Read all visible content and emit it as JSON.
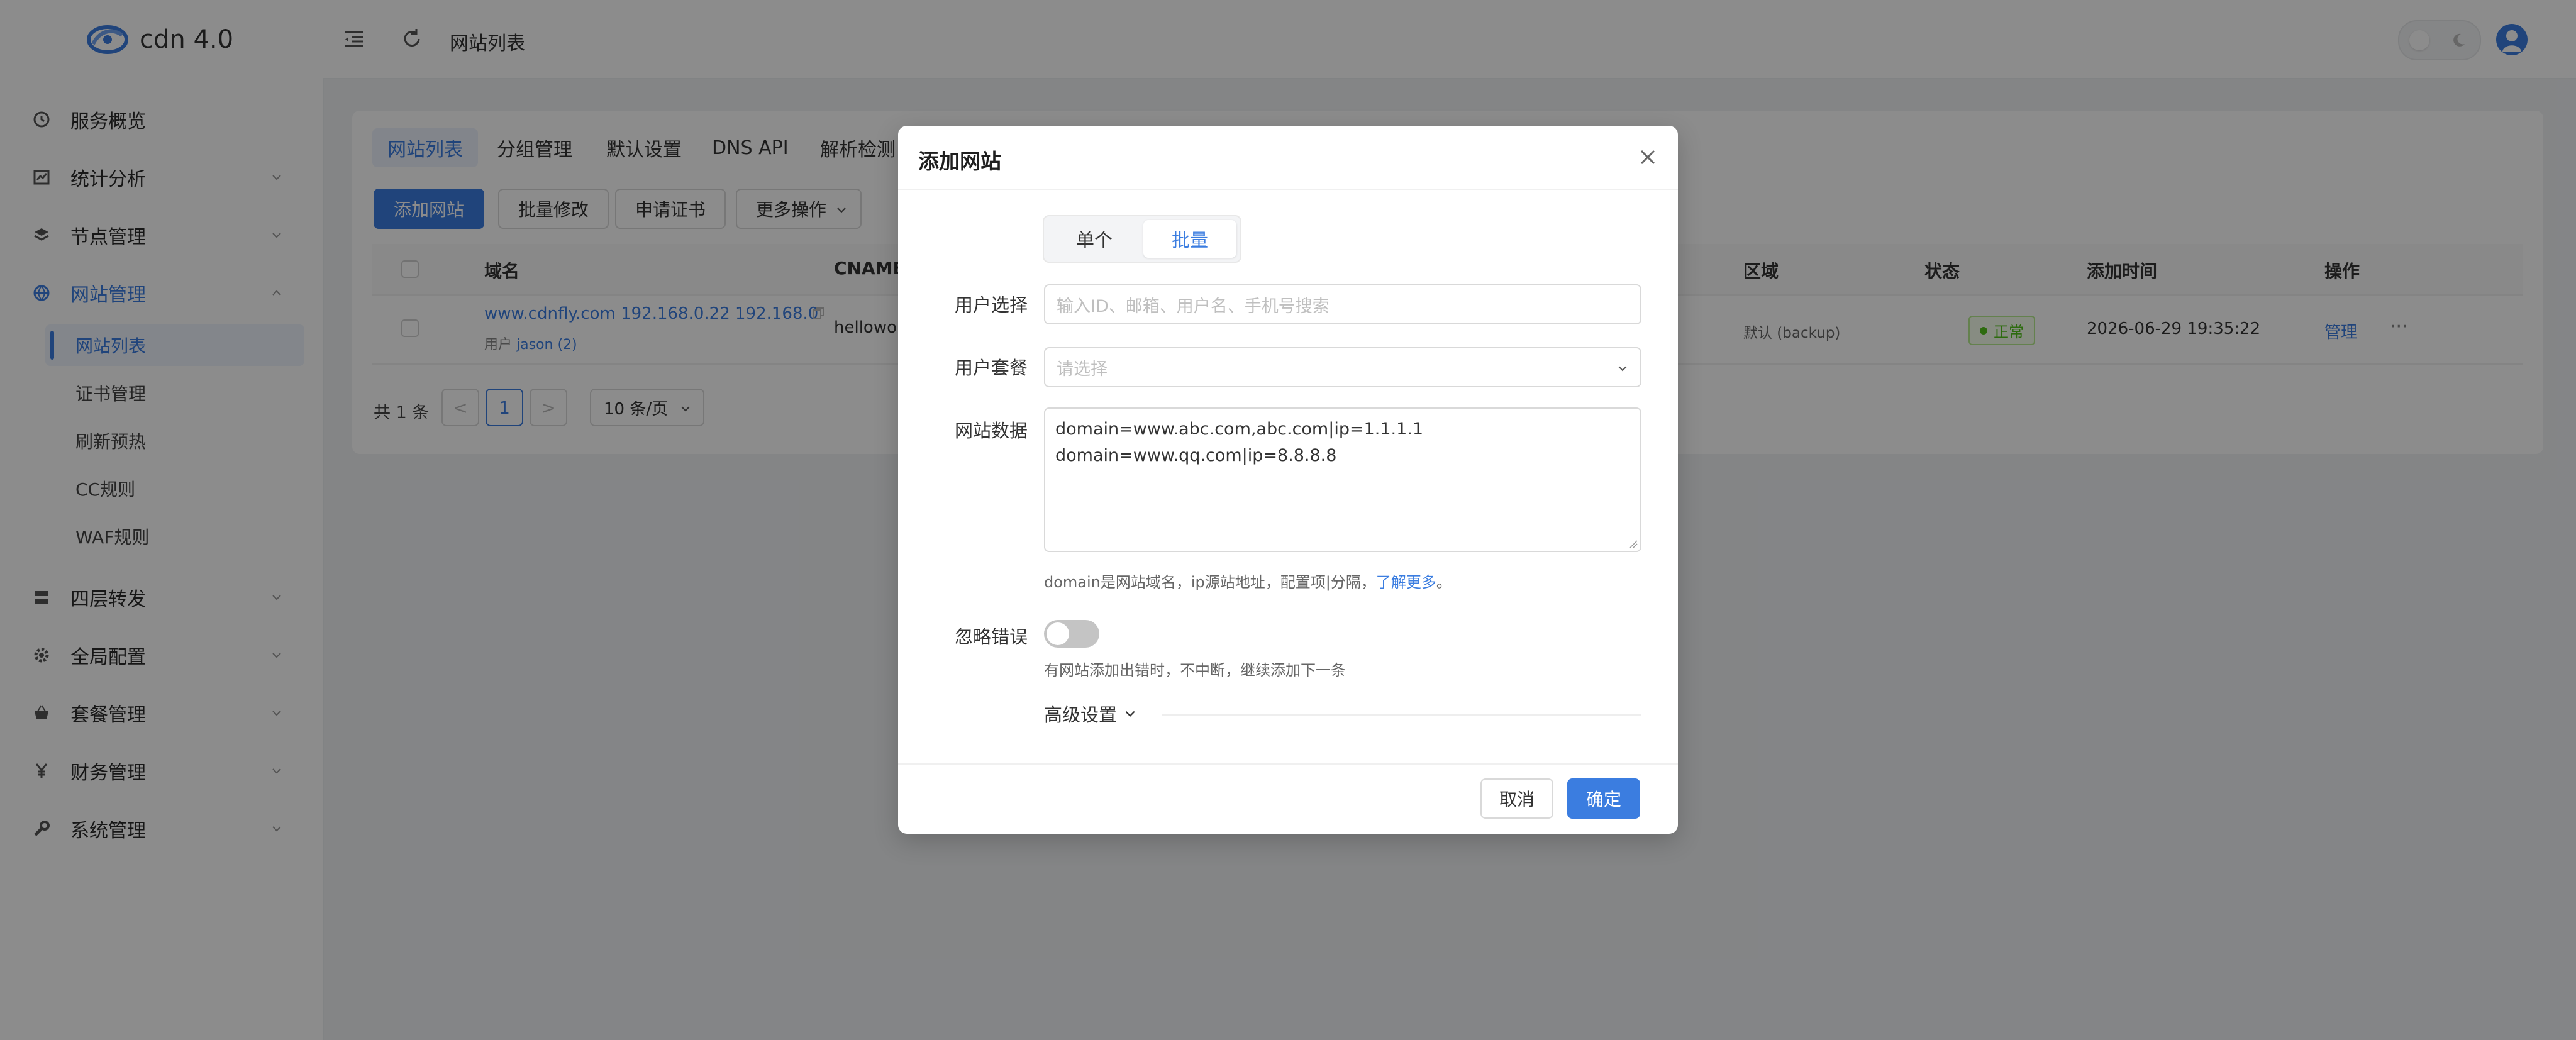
{
  "app": {
    "title": "cdn 4.0"
  },
  "sidebar": {
    "items": [
      {
        "label": "服务概览",
        "icon": "dashboard-icon"
      },
      {
        "label": "统计分析",
        "icon": "chart-icon"
      },
      {
        "label": "节点管理",
        "icon": "layers-icon"
      },
      {
        "label": "网站管理",
        "icon": "globe-icon"
      },
      {
        "label": "四层转发",
        "icon": "server-icon"
      },
      {
        "label": "全局配置",
        "icon": "gear-icon"
      },
      {
        "label": "套餐管理",
        "icon": "basket-icon"
      },
      {
        "label": "财务管理",
        "icon": "yen-icon"
      },
      {
        "label": "系统管理",
        "icon": "wrench-icon"
      }
    ],
    "sub_items": [
      "网站列表",
      "证书管理",
      "刷新预热",
      "CC规则",
      "WAF规则"
    ]
  },
  "header": {
    "page_title": "网站列表"
  },
  "tabs": [
    "网站列表",
    "分组管理",
    "默认设置",
    "DNS API",
    "解析检测"
  ],
  "toolbar": {
    "add": "添加网站",
    "batch_edit": "批量修改",
    "apply_cert": "申请证书",
    "more": "更多操作"
  },
  "table": {
    "columns": {
      "domain": "域名",
      "cname": "CNAME",
      "region": "区域",
      "status": "状态",
      "added": "添加时间",
      "actions": "操作"
    },
    "rows": [
      {
        "domain": "www.cdnfly.com 192.168.0.22 192.168.0",
        "user_label": "用户",
        "user": "jason (2)",
        "cname": "hellowor",
        "region": "默认 (backup)",
        "status": "正常",
        "added": "2026-06-29 19:35:22",
        "manage": "管理",
        "more": "···"
      }
    ]
  },
  "pagination": {
    "total": "共 1 条",
    "prev": "<",
    "page": "1",
    "next": ">",
    "page_size": "10 条/页"
  },
  "modal": {
    "title": "添加网站",
    "modes": [
      "单个",
      "批量"
    ],
    "selected_mode": "批量",
    "user_select": {
      "label": "用户选择",
      "placeholder": "输入ID、邮箱、用户名、手机号搜索"
    },
    "user_plan": {
      "label": "用户套餐",
      "placeholder": "请选择"
    },
    "site_data": {
      "label": "网站数据",
      "lines": [
        "domain=www.abc.com,abc.com|ip=1.1.1.1",
        "domain=www.qq.com|ip=8.8.8.8"
      ],
      "help": "domain是网站域名，ip源站地址，配置项|分隔，",
      "help_link": "了解更多",
      "help_end": "。"
    },
    "ignore_errors": {
      "label": "忽略错误",
      "enabled": false,
      "help": "有网站添加出错时，不中断，继续添加下一条"
    },
    "advanced": "高级设置",
    "cancel": "取消",
    "confirm": "确定"
  },
  "colors": {
    "accent": "#3b7de0",
    "success": "#52c41a"
  }
}
